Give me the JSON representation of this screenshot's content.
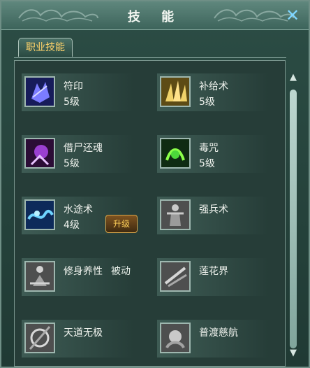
{
  "window": {
    "title": "技  能",
    "close_icon": "close-icon",
    "title_color": "#f3f7f2"
  },
  "tabs": [
    {
      "label": "职业技能",
      "active": true
    }
  ],
  "skills": [
    {
      "name": "符印",
      "level": "5级",
      "icon": "sigil-icon",
      "passive": "",
      "upgrade": ""
    },
    {
      "name": "补给术",
      "level": "5级",
      "icon": "supply-icon",
      "passive": "",
      "upgrade": ""
    },
    {
      "name": "借尸还魂",
      "level": "5级",
      "icon": "resurrect-icon",
      "passive": "",
      "upgrade": ""
    },
    {
      "name": "毒咒",
      "level": "5级",
      "icon": "poison-icon",
      "passive": "",
      "upgrade": ""
    },
    {
      "name": "水途术",
      "level": "4级",
      "icon": "water-icon",
      "passive": "",
      "upgrade": "升级"
    },
    {
      "name": "强兵术",
      "level": "",
      "icon": "warrior-icon",
      "passive": "",
      "upgrade": ""
    },
    {
      "name": "修身养性",
      "level": "",
      "icon": "meditate-icon",
      "passive": "被动",
      "upgrade": ""
    },
    {
      "name": "莲花界",
      "level": "",
      "icon": "lotus-icon",
      "passive": "",
      "upgrade": ""
    },
    {
      "name": "天道无极",
      "level": "",
      "icon": "heaven-icon",
      "passive": "",
      "upgrade": ""
    },
    {
      "name": "普渡慈航",
      "level": "",
      "icon": "salvation-icon",
      "passive": "",
      "upgrade": ""
    }
  ],
  "scroll": {
    "up_icon": "scroll-up-icon",
    "down_icon": "scroll-down-icon"
  }
}
